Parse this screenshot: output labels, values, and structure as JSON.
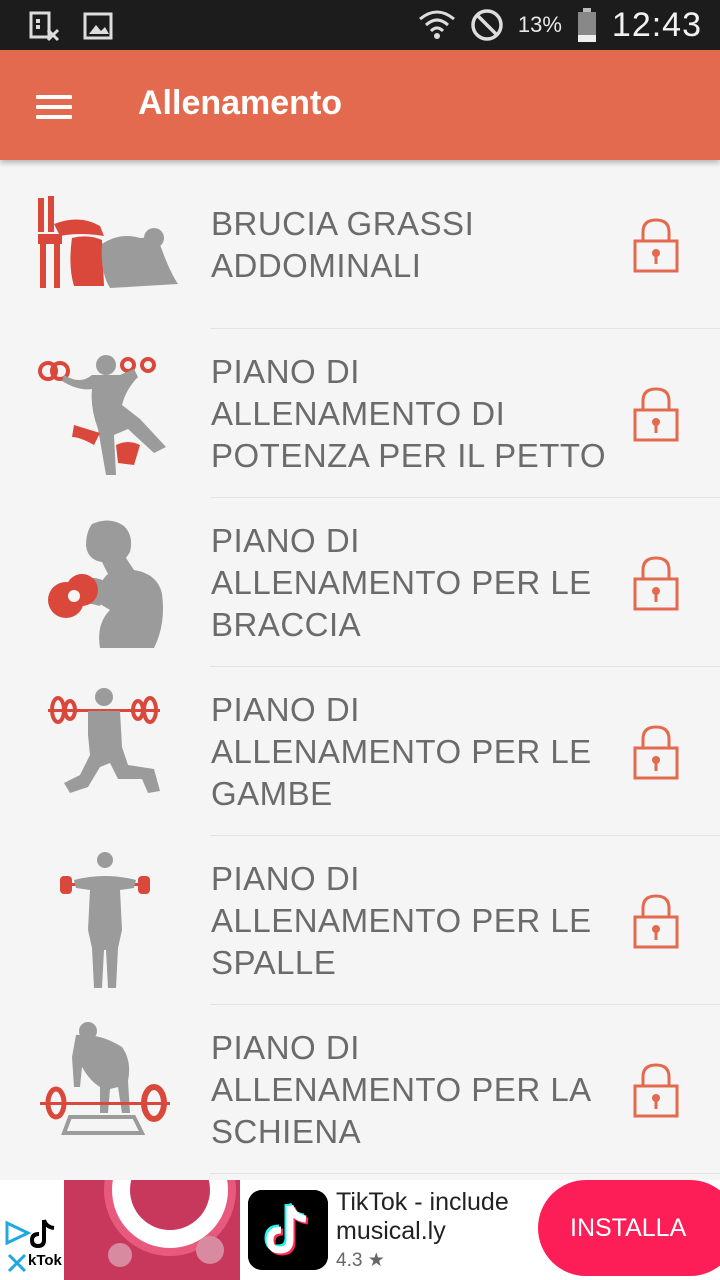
{
  "status_bar": {
    "battery_percent": "13%",
    "time": "12:43"
  },
  "app_bar": {
    "title": "Allenamento",
    "menu_icon": "hamburger-menu-icon"
  },
  "workouts": [
    {
      "label": "BRUCIA GRASSI ADDOMINALI",
      "icon": "abs-crunch-icon",
      "locked": true
    },
    {
      "label": "PIANO DI ALLENAMENTO DI POTENZA PER IL PETTO",
      "icon": "chest-press-icon",
      "locked": true
    },
    {
      "label": "PIANO DI ALLENAMENTO PER LE BRACCIA",
      "icon": "bicep-curl-icon",
      "locked": true
    },
    {
      "label": "PIANO DI ALLENAMENTO PER LE GAMBE",
      "icon": "barbell-lunge-icon",
      "locked": true
    },
    {
      "label": "PIANO DI ALLENAMENTO PER LE SPALLE",
      "icon": "shoulder-raise-icon",
      "locked": true
    },
    {
      "label": "PIANO DI ALLENAMENTO PER LA SCHIENA",
      "icon": "deadlift-icon",
      "locked": true
    }
  ],
  "ad": {
    "image_brand": "kTok",
    "app_title": "TikTok - include musical.ly",
    "rating": "4.3 ★",
    "install_label": "INSTALLA"
  },
  "colors": {
    "accent": "#e46a4f",
    "lock": "#e46a4f",
    "figure_red": "#d9483a",
    "figure_gray": "#9b9b9b",
    "install_button": "#fe1e57"
  }
}
